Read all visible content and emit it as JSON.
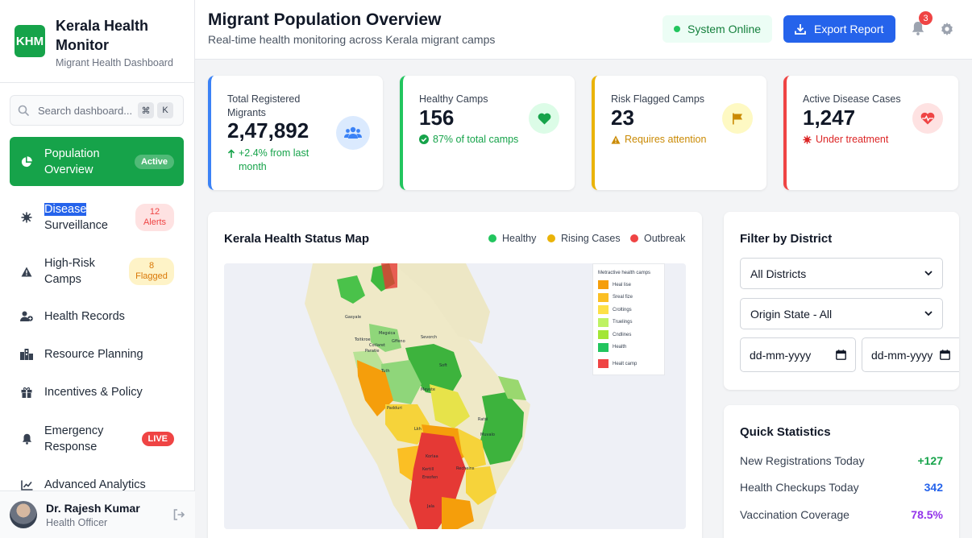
{
  "brand": {
    "logo": "KHM",
    "title": "Kerala Health Monitor",
    "subtitle": "Migrant Health Dashboard"
  },
  "search": {
    "placeholder": "Search dashboard...",
    "kbd1": "⌘",
    "kbd2": "K"
  },
  "nav": [
    {
      "label": "Population Overview",
      "badge": "Active",
      "icon": "pie-chart-icon"
    },
    {
      "label_hl": "Disease",
      "label_rest": "Surveillance",
      "badge": "12 Alerts",
      "icon": "virus-icon"
    },
    {
      "label": "High-Risk Camps",
      "badge": "8 Flagged",
      "icon": "warning-icon"
    },
    {
      "label": "Health Records",
      "icon": "user-medical-icon"
    },
    {
      "label": "Resource Planning",
      "icon": "city-icon"
    },
    {
      "label": "Incentives & Policy",
      "icon": "gift-icon"
    },
    {
      "label": "Emergency Response",
      "badge": "LIVE",
      "icon": "bell-icon"
    },
    {
      "label": "Advanced Analytics",
      "icon": "line-chart-icon"
    }
  ],
  "user": {
    "name": "Dr. Rajesh Kumar",
    "role": "Health Officer"
  },
  "header": {
    "title": "Migrant Population Overview",
    "subtitle": "Real-time health monitoring across Kerala migrant camps",
    "status": "System Online",
    "export": "Export Report",
    "notifications": "3"
  },
  "stats": [
    {
      "label": "Total Registered Migrants",
      "value": "2,47,892",
      "note": "+2.4% from last month",
      "color": "#3b82f6",
      "icon": "users-icon"
    },
    {
      "label": "Healthy Camps",
      "value": "156",
      "note": "87% of total camps",
      "color": "#22c55e",
      "icon": "heart-icon"
    },
    {
      "label": "Risk Flagged Camps",
      "value": "23",
      "note": "Requires attention",
      "color": "#eab308",
      "icon": "flag-icon"
    },
    {
      "label": "Active Disease Cases",
      "value": "1,247",
      "note": "Under treatment",
      "color": "#ef4444",
      "icon": "heartbeat-icon"
    }
  ],
  "map": {
    "title": "Kerala Health Status Map",
    "legend": [
      {
        "label": "Healthy",
        "color": "#22c55e"
      },
      {
        "label": "Rising Cases",
        "color": "#eab308"
      },
      {
        "label": "Outbreak",
        "color": "#ef4444"
      }
    ],
    "map_legend_title": "Metractive health camps",
    "map_legend": [
      {
        "label": "Heal lise",
        "color": "#f59e0b"
      },
      {
        "label": "Sreal fize",
        "color": "#fbbf24"
      },
      {
        "label": "Croltings",
        "color": "#fde047"
      },
      {
        "label": "Truelings",
        "color": "#bef264"
      },
      {
        "label": "Cndlines",
        "color": "#a3e635"
      },
      {
        "label": "Health",
        "color": "#22c55e"
      },
      {
        "label": "Healt camp",
        "color": "#ef4444"
      }
    ],
    "places": [
      "Gasyale",
      "Megsica",
      "Toitkroe",
      "Paratie",
      "Gffeno",
      "Sevorch",
      "Cotlaret",
      "Tuth",
      "Soft",
      "Meyste",
      "Padduri",
      "Lkh",
      "Ratsi",
      "Muvalo",
      "Korlaa",
      "Kertill",
      "Ereofen",
      "Recheins",
      "Jala"
    ]
  },
  "filter": {
    "title": "Filter by District",
    "district": "All Districts",
    "origin": "Origin State - All",
    "date_from": "dd-mm-yyyy",
    "date_to": "dd-mm-yyyy"
  },
  "quick_stats": {
    "title": "Quick Statistics",
    "rows": [
      {
        "label": "New Registrations Today",
        "value": "+127",
        "color": "#16a34a"
      },
      {
        "label": "Health Checkups Today",
        "value": "342",
        "color": "#2563eb"
      },
      {
        "label": "Vaccination Coverage",
        "value": "78.5%",
        "color": "#9333ea"
      }
    ]
  }
}
